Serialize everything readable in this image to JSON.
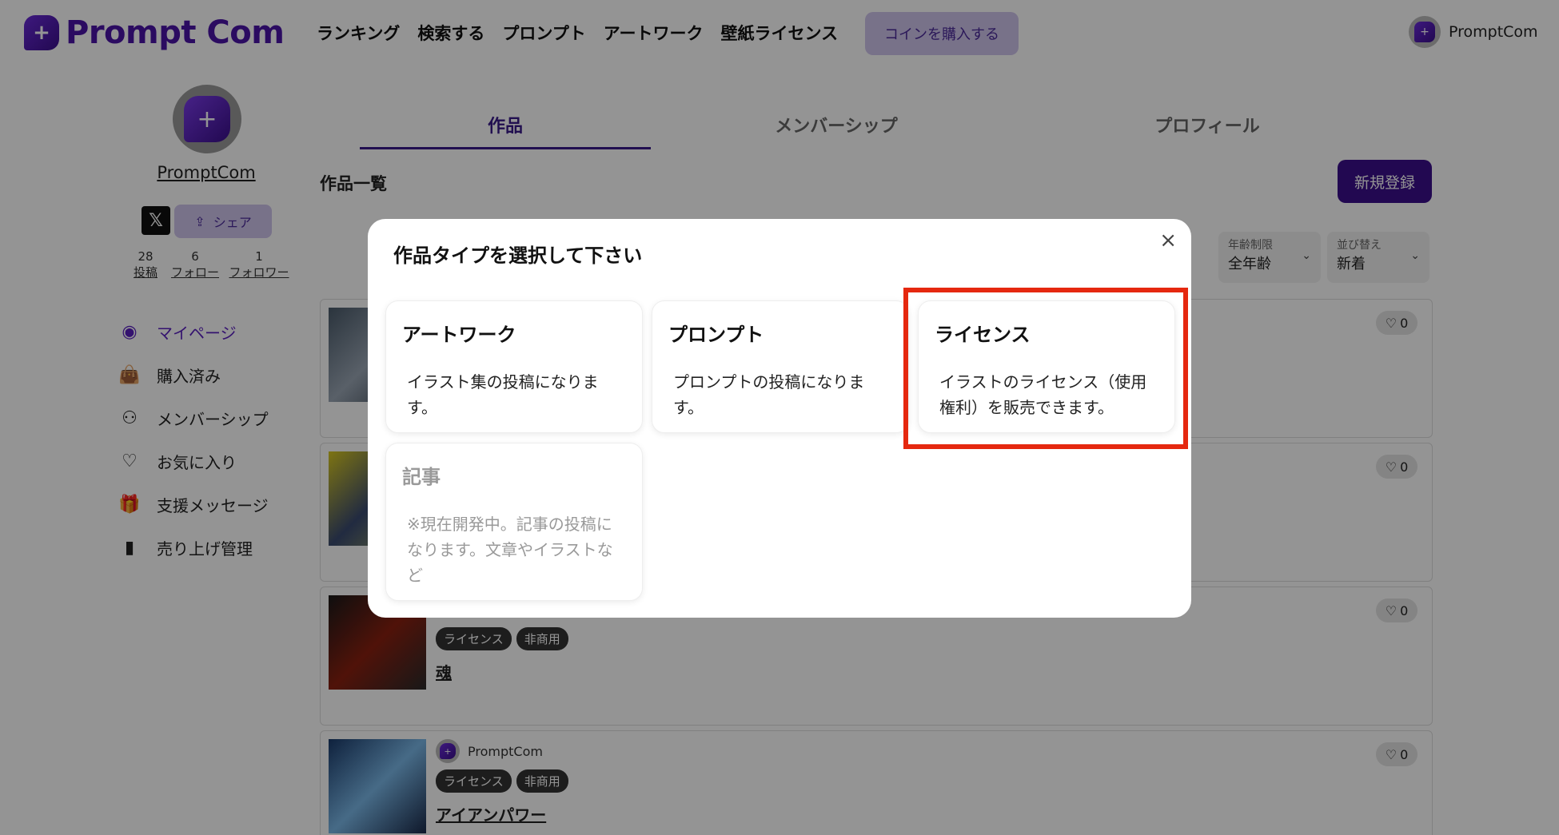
{
  "header": {
    "logo_text": "Prompt Com",
    "nav": [
      "ランキング",
      "検索する",
      "プロンプト",
      "アートワーク",
      "壁紙ライセンス"
    ],
    "coin_button": "コインを購入する",
    "user_name": "PromptCom"
  },
  "sidebar": {
    "profile_name": "PromptCom",
    "share_label": "シェア",
    "stats": [
      {
        "value": "28",
        "label": "投稿"
      },
      {
        "value": "6",
        "label": "フォロー"
      },
      {
        "value": "1",
        "label": "フォロワー"
      }
    ],
    "menu": [
      {
        "label": "マイページ",
        "icon": "user-circle-icon"
      },
      {
        "label": "購入済み",
        "icon": "shopping-bag-icon"
      },
      {
        "label": "メンバーシップ",
        "icon": "users-icon"
      },
      {
        "label": "お気に入り",
        "icon": "heart-icon"
      },
      {
        "label": "支援メッセージ",
        "icon": "gift-icon"
      },
      {
        "label": "売り上げ管理",
        "icon": "bar-chart-icon"
      }
    ]
  },
  "main": {
    "tabs": [
      "作品",
      "メンバーシップ",
      "プロフィール"
    ],
    "list_title": "作品一覧",
    "new_button": "新規登録",
    "filters": [
      {
        "caption": "年齢制限",
        "value": "全年齢"
      },
      {
        "caption": "並び替え",
        "value": "新着"
      }
    ],
    "cards": [
      {
        "likes": "0"
      },
      {
        "likes": "0"
      },
      {
        "likes": "0",
        "tags": [
          "ライセンス",
          "非商用"
        ],
        "title": "魂"
      },
      {
        "likes": "0",
        "author": "PromptCom",
        "tags": [
          "ライセンス",
          "非商用"
        ],
        "title": "アイアンパワー"
      }
    ]
  },
  "modal": {
    "title": "作品タイプを選択して下さい",
    "close": "×",
    "options": [
      {
        "title": "アートワーク",
        "desc": "イラスト集の投稿になります。"
      },
      {
        "title": "プロンプト",
        "desc": "プロンプトの投稿になります。"
      },
      {
        "title": "ライセンス",
        "desc": "イラストのライセンス（使用権利）を販売できます。"
      },
      {
        "title": "記事",
        "desc": "※現在開発中。記事の投稿になります。文章やイラストなど"
      }
    ]
  },
  "colors": {
    "brand": "#3b0f8c",
    "highlight": "#e5280f"
  }
}
